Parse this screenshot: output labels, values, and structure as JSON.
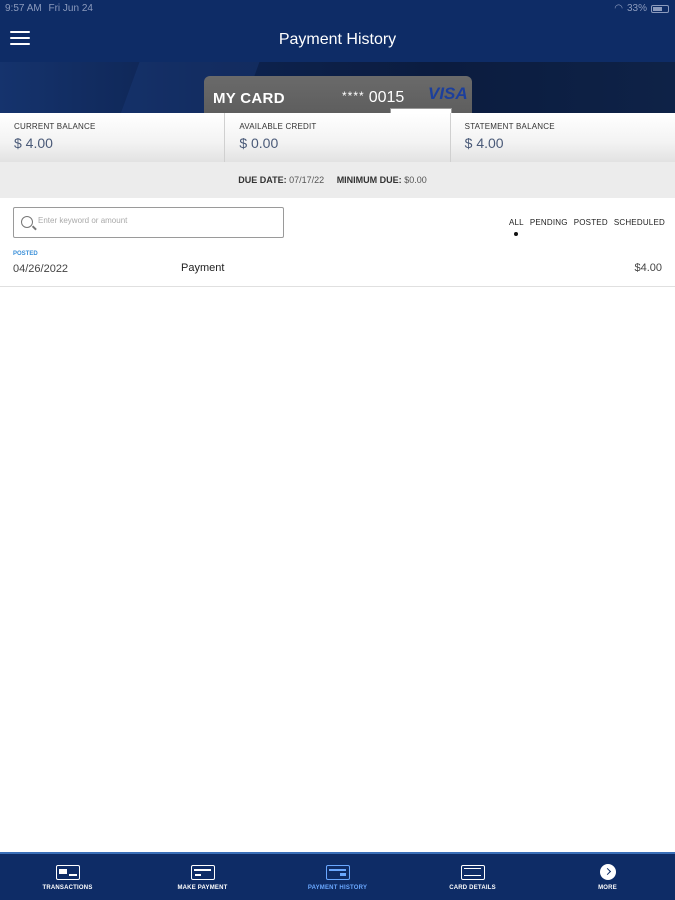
{
  "status_bar": {
    "time": "9:57 AM",
    "date": "Fri Jun 24",
    "battery": "33%"
  },
  "header": {
    "title": "Payment History"
  },
  "card": {
    "name": "MY CARD",
    "mask": "****",
    "last4": "0015",
    "network": "VISA"
  },
  "balances": [
    {
      "label": "CURRENT BALANCE",
      "value": "$ 4.00"
    },
    {
      "label": "AVAILABLE CREDIT",
      "value": "$ 0.00"
    },
    {
      "label": "STATEMENT BALANCE",
      "value": "$ 4.00"
    }
  ],
  "due": {
    "due_date_label": "DUE DATE:",
    "due_date": "07/17/22",
    "minimum_due_label": "MINIMUM DUE:",
    "minimum_due": "$0.00"
  },
  "search": {
    "placeholder": "Enter keyword or amount"
  },
  "filters": [
    {
      "label": "ALL",
      "active": true
    },
    {
      "label": "PENDING",
      "active": false
    },
    {
      "label": "POSTED",
      "active": false
    },
    {
      "label": "SCHEDULED",
      "active": false
    }
  ],
  "transactions": [
    {
      "status": "POSTED",
      "date": "04/26/2022",
      "description": "Payment",
      "amount": "$4.00"
    }
  ],
  "tabs": [
    {
      "label": "TRANSACTIONS",
      "icon": "card-icon",
      "active": false
    },
    {
      "label": "MAKE PAYMENT",
      "icon": "payment-icon",
      "active": false
    },
    {
      "label": "PAYMENT HISTORY",
      "icon": "payment-history-icon",
      "active": true
    },
    {
      "label": "CARD DETAILS",
      "icon": "card-details-icon",
      "active": false
    },
    {
      "label": "MORE",
      "icon": "more-icon",
      "active": false
    }
  ],
  "colors": {
    "nav_bg": "#0e2c66",
    "accent": "#6aa8ff",
    "posted": "#3a8fd8"
  }
}
